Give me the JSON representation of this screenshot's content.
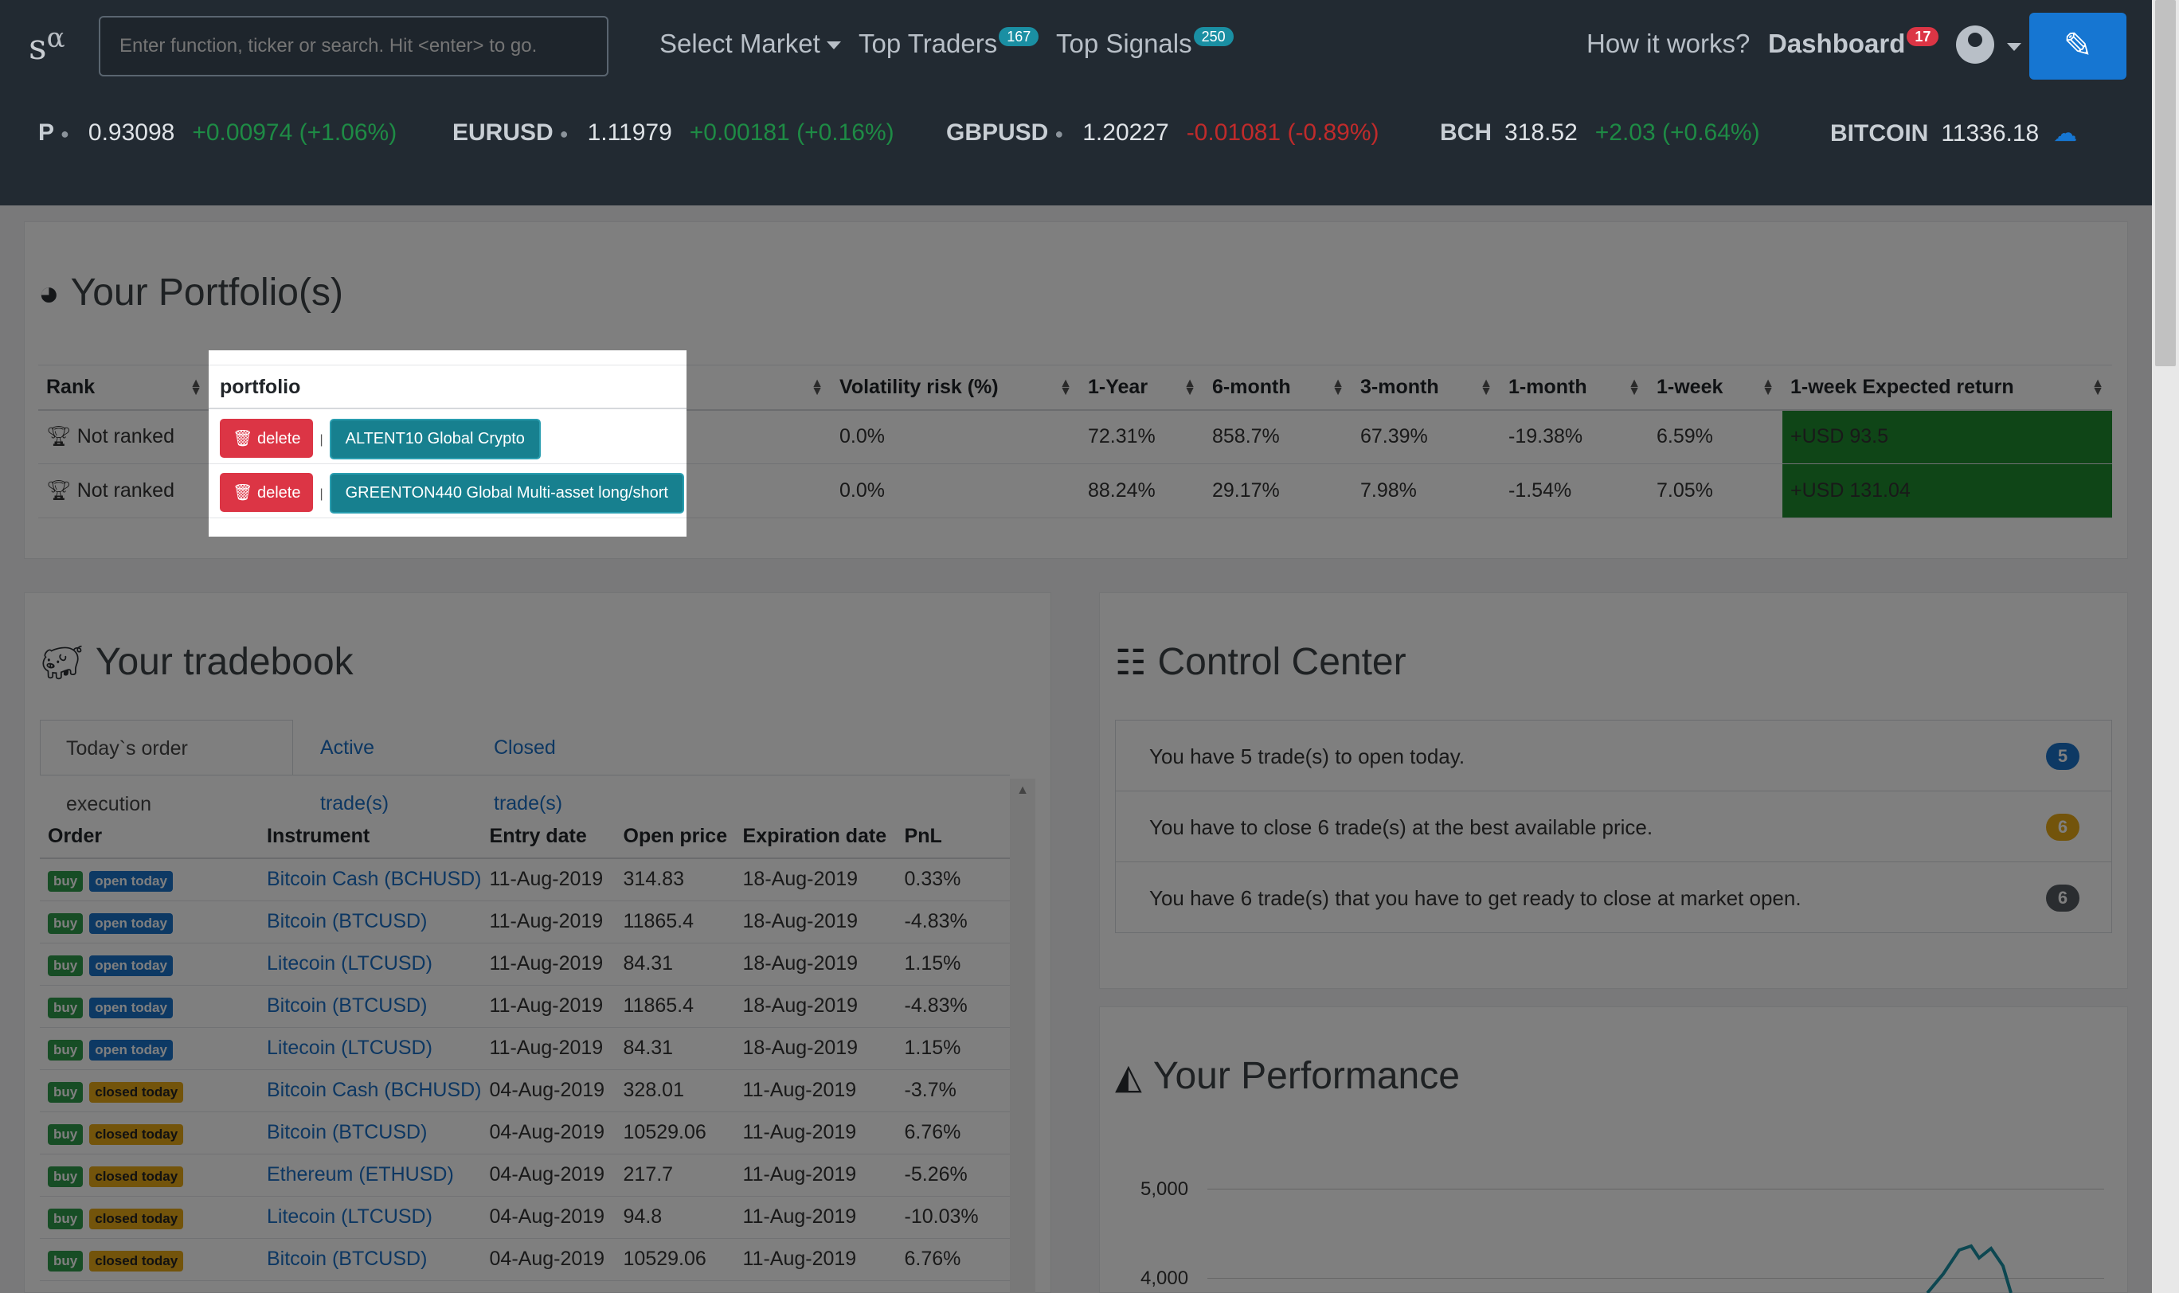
{
  "logo": {
    "text": "s",
    "sup": "α"
  },
  "search": {
    "placeholder": "Enter function, ticker or search. Hit <enter> to go."
  },
  "nav": {
    "select_market": "Select Market",
    "top_traders": "Top Traders",
    "top_traders_count": "167",
    "top_signals": "Top Signals",
    "top_signals_count": "250",
    "how_it_works": "How it works?",
    "dashboard": "Dashboard",
    "dashboard_count": "17"
  },
  "ticker": [
    {
      "sym": "P",
      "price": "0.93098",
      "change": "+0.00974 (+1.06%)",
      "dir": "up"
    },
    {
      "sym": "EURUSD",
      "price": "1.11979",
      "change": "+0.00181 (+0.16%)",
      "dir": "up"
    },
    {
      "sym": "GBPUSD",
      "price": "1.20227",
      "change": "-0.01081 (-0.89%)",
      "dir": "down"
    },
    {
      "sym": "BCH",
      "price": "318.52",
      "change": "+2.03 (+0.64%)",
      "dir": "up"
    },
    {
      "sym": "BITCOIN",
      "price": "11336.18",
      "change": "",
      "dir": "up"
    }
  ],
  "portfolio": {
    "title": "Your Portfolio(s)",
    "headers": [
      "Rank",
      "portfolio",
      "Volatility risk (%)",
      "1-Year",
      "6-month",
      "3-month",
      "1-month",
      "1-week",
      "1-week Expected return"
    ],
    "rows": [
      {
        "rank": "Not ranked",
        "delete": "delete",
        "name": "ALTENT10 Global Crypto",
        "vol": "0.0%",
        "y1": "72.31%",
        "m6": "858.7%",
        "m3": "67.39%",
        "m1": "-19.38%",
        "w1": "6.59%",
        "exp": "+USD 93.5"
      },
      {
        "rank": "Not ranked",
        "delete": "delete",
        "name": "GREENTON440 Global Multi-asset long/short",
        "vol": "0.0%",
        "y1": "88.24%",
        "m6": "29.17%",
        "m3": "7.98%",
        "m1": "-1.54%",
        "w1": "7.05%",
        "exp": "+USD 131.04"
      }
    ]
  },
  "tradebook": {
    "title": "Your tradebook",
    "tabs": [
      "Today`s order execution",
      "Active trade(s)",
      "Closed trade(s)"
    ],
    "headers": [
      "Order",
      "Instrument",
      "Entry date",
      "Open price",
      "Expiration date",
      "PnL"
    ],
    "rows": [
      {
        "side": "buy",
        "status": "open today",
        "inst": "Bitcoin Cash (BCHUSD)",
        "entry": "11-Aug-2019",
        "open": "314.83",
        "exp": "18-Aug-2019",
        "pnl": "0.33%"
      },
      {
        "side": "buy",
        "status": "open today",
        "inst": "Bitcoin (BTCUSD)",
        "entry": "11-Aug-2019",
        "open": "11865.4",
        "exp": "18-Aug-2019",
        "pnl": "-4.83%"
      },
      {
        "side": "buy",
        "status": "open today",
        "inst": "Litecoin (LTCUSD)",
        "entry": "11-Aug-2019",
        "open": "84.31",
        "exp": "18-Aug-2019",
        "pnl": "1.15%"
      },
      {
        "side": "buy",
        "status": "open today",
        "inst": "Bitcoin (BTCUSD)",
        "entry": "11-Aug-2019",
        "open": "11865.4",
        "exp": "18-Aug-2019",
        "pnl": "-4.83%"
      },
      {
        "side": "buy",
        "status": "open today",
        "inst": "Litecoin (LTCUSD)",
        "entry": "11-Aug-2019",
        "open": "84.31",
        "exp": "18-Aug-2019",
        "pnl": "1.15%"
      },
      {
        "side": "buy",
        "status": "closed today",
        "inst": "Bitcoin Cash (BCHUSD)",
        "entry": "04-Aug-2019",
        "open": "328.01",
        "exp": "11-Aug-2019",
        "pnl": "-3.7%"
      },
      {
        "side": "buy",
        "status": "closed today",
        "inst": "Bitcoin (BTCUSD)",
        "entry": "04-Aug-2019",
        "open": "10529.06",
        "exp": "11-Aug-2019",
        "pnl": "6.76%"
      },
      {
        "side": "buy",
        "status": "closed today",
        "inst": "Ethereum (ETHUSD)",
        "entry": "04-Aug-2019",
        "open": "217.7",
        "exp": "11-Aug-2019",
        "pnl": "-5.26%"
      },
      {
        "side": "buy",
        "status": "closed today",
        "inst": "Litecoin (LTCUSD)",
        "entry": "04-Aug-2019",
        "open": "94.8",
        "exp": "11-Aug-2019",
        "pnl": "-10.03%"
      },
      {
        "side": "buy",
        "status": "closed today",
        "inst": "Bitcoin (BTCUSD)",
        "entry": "04-Aug-2019",
        "open": "10529.06",
        "exp": "11-Aug-2019",
        "pnl": "6.76%"
      }
    ]
  },
  "control_center": {
    "title": "Control Center",
    "items": [
      {
        "text": "You have 5 trade(s) to open today.",
        "count": "5",
        "color": "#1a73c9"
      },
      {
        "text": "You have to close 6 trade(s) at the best available price.",
        "count": "6",
        "color": "#e6a817"
      },
      {
        "text": "You have 6 trade(s) that you have to get ready to close at market open.",
        "count": "6",
        "color": "#555b61"
      }
    ]
  },
  "performance": {
    "title": "Your Performance",
    "y_ticks": [
      "5,000",
      "4,000"
    ]
  },
  "colors": {
    "positive": "#2e9a4e",
    "negative": "#d23b3b",
    "accent": "#1676d2",
    "header_bg": "#222a32"
  }
}
